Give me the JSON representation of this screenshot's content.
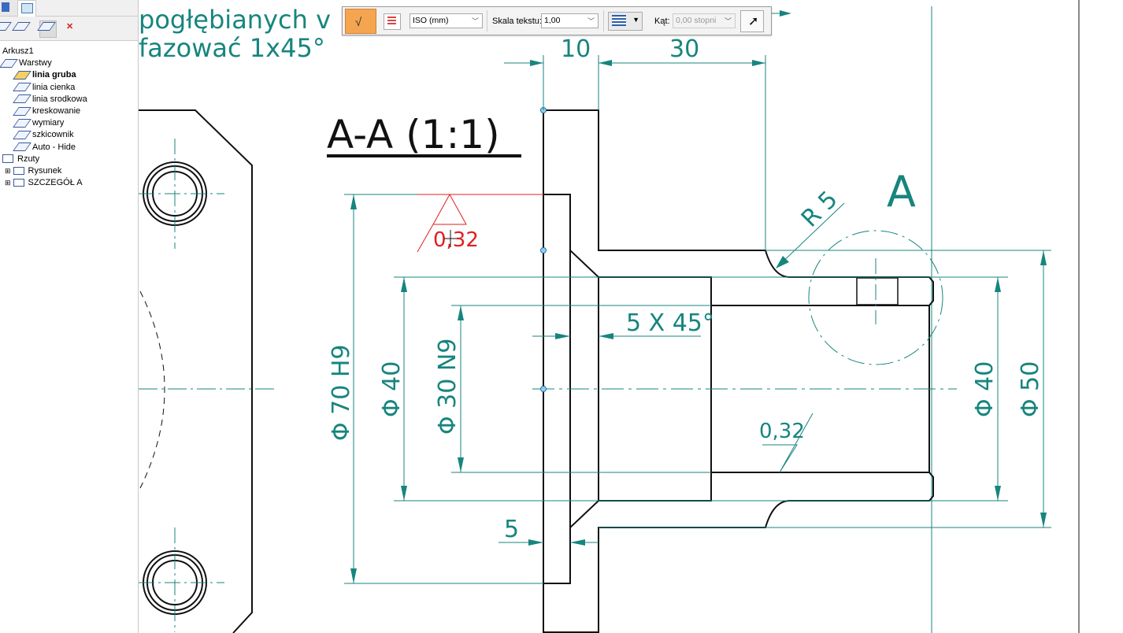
{
  "panel": {
    "tree": {
      "root": "Arkusz1",
      "layers_label": "Warstwy",
      "layers": [
        "linia gruba",
        "linia cienka",
        "linia srodkowa",
        "kreskowanie",
        "wymiary",
        "szkicownik",
        "Auto - Hide"
      ],
      "active_layer": "linia gruba",
      "views_label": "Rzuty",
      "views": [
        "Rysunek",
        "SZCZEGÓŁ A"
      ]
    }
  },
  "toolbar": {
    "standard": "ISO (mm)",
    "text_scale_label": "Skala tekstu:",
    "text_scale": "1,00",
    "angle_label": "Kąt:",
    "angle": "0,00 stopni"
  },
  "drawing": {
    "note_line1": "pogłębianych v",
    "note_line2": "fazować 1x45°",
    "section_title": "A-A (1:1)",
    "detail_label": "A",
    "dims": {
      "d10": "10",
      "d30": "30",
      "phi70": "Φ 70  H9",
      "phi40_left": "Φ 40",
      "phi30": "Φ 30  N9",
      "chamfer": "5 X 45°",
      "d5": "5",
      "phi40_right": "Φ 40",
      "phi50": "Φ 50",
      "r5": "R 5",
      "rough_bottom": "0,32",
      "rough_red": "0,32"
    },
    "colors": {
      "dimension": "#17857e",
      "edit": "#e02020",
      "geometry": "#111111"
    }
  }
}
